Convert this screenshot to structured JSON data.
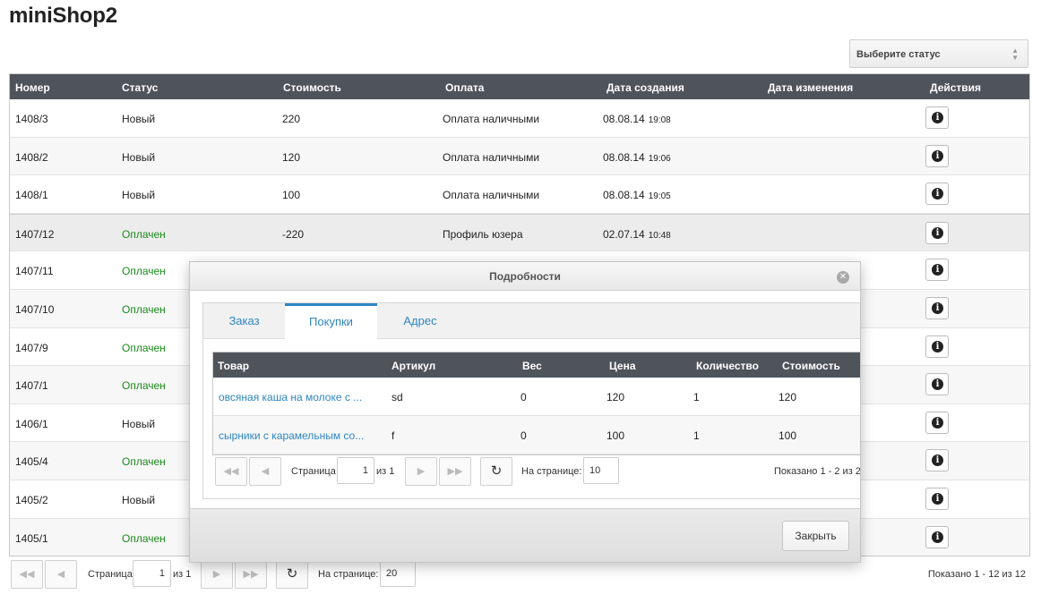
{
  "app": {
    "title": "miniShop2"
  },
  "status_filter": {
    "placeholder": "Выберите статус"
  },
  "orders_grid": {
    "columns": [
      "Номер",
      "Статус",
      "Стоимость",
      "Оплата",
      "Дата создания",
      "Дата изменения",
      "Действия"
    ],
    "rows": [
      {
        "num": "1408/3",
        "status": "Новый",
        "cost": "220",
        "payment": "Оплата наличными",
        "date": "08.08.14",
        "time": "19:08",
        "paid": false
      },
      {
        "num": "1408/2",
        "status": "Новый",
        "cost": "120",
        "payment": "Оплата наличными",
        "date": "08.08.14",
        "time": "19:06",
        "paid": false
      },
      {
        "num": "1408/1",
        "status": "Новый",
        "cost": "100",
        "payment": "Оплата наличными",
        "date": "08.08.14",
        "time": "19:05",
        "paid": false
      },
      {
        "num": "1407/12",
        "status": "Оплачен",
        "cost": "-220",
        "payment": "Профиль юзера",
        "date": "02.07.14",
        "time": "10:48",
        "paid": true
      },
      {
        "num": "1407/11",
        "status": "Оплачен",
        "paid": true
      },
      {
        "num": "1407/10",
        "status": "Оплачен",
        "paid": true
      },
      {
        "num": "1407/9",
        "status": "Оплачен",
        "paid": true
      },
      {
        "num": "1407/1",
        "status": "Оплачен",
        "paid": true
      },
      {
        "num": "1406/1",
        "status": "Новый",
        "paid": false
      },
      {
        "num": "1405/4",
        "status": "Оплачен",
        "paid": true
      },
      {
        "num": "1405/2",
        "status": "Новый",
        "paid": false
      },
      {
        "num": "1405/1",
        "status": "Оплачен",
        "paid": true
      }
    ]
  },
  "main_pager": {
    "page_label": "Страница",
    "page_value": "1",
    "of_label": "из 1",
    "per_page_label": "На странице:",
    "per_page_value": "20",
    "summary": "Показано 1 - 12 из 12"
  },
  "modal": {
    "title": "Подробности",
    "tabs": [
      "Заказ",
      "Покупки",
      "Адрес"
    ],
    "active_tab": 1,
    "items_columns": [
      "Товар",
      "Артикул",
      "Вес",
      "Цена",
      "Количество",
      "Стоимость"
    ],
    "items": [
      {
        "name": "овсяная каша на молоке с ...",
        "sku": "sd",
        "weight": "0",
        "price": "120",
        "qty": "1",
        "cost": "120"
      },
      {
        "name": "сырники с карамельным со...",
        "sku": "f",
        "weight": "0",
        "price": "100",
        "qty": "1",
        "cost": "100"
      }
    ],
    "pager": {
      "page_label": "Страница",
      "page_value": "1",
      "of_label": "из 1",
      "per_page_label": "На странице:",
      "per_page_value": "10",
      "summary": "Показано 1 - 2 из 2"
    },
    "close_label": "Закрыть"
  }
}
